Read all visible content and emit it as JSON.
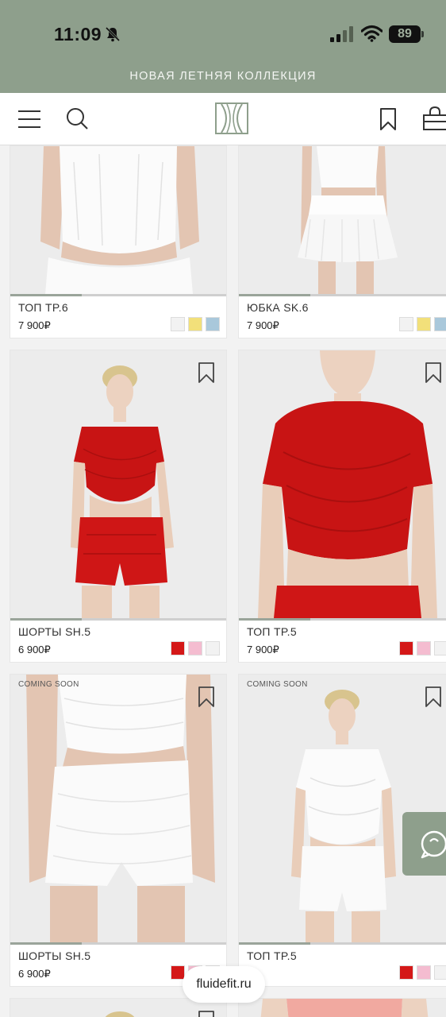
{
  "status_bar": {
    "time": "11:09",
    "battery": "89"
  },
  "promo_banner": "НОВАЯ ЛЕТНЯЯ КОЛЛЕКЦИЯ",
  "products": [
    {
      "name": "ТОП TP.6",
      "price": "7 900₽",
      "colors": [
        "#f2f2f2",
        "#f2e07a",
        "#a9c8db"
      ]
    },
    {
      "name": "ЮБКА SK.6",
      "price": "7 900₽",
      "colors": [
        "#f2f2f2",
        "#f2e07a",
        "#a9c8db"
      ]
    },
    {
      "name": "ШОРТЫ SH.5",
      "price": "6 900₽",
      "colors": [
        "#d41818",
        "#f4bcd0",
        "#f2f2f2"
      ]
    },
    {
      "name": "ТОП TP.5",
      "price": "7 900₽",
      "colors": [
        "#d41818",
        "#f4bcd0",
        "#f2f2f2"
      ]
    },
    {
      "name": "ШОРТЫ SH.5",
      "price": "6 900₽",
      "badge": "COMING SOON",
      "colors": [
        "#d41818",
        "#f4bcd0",
        "#f2f2f2"
      ]
    },
    {
      "name": "ТОП TP.5",
      "price": "",
      "badge": "COMING SOON",
      "colors": [
        "#d41818",
        "#f4bcd0",
        "#f2f2f2"
      ]
    }
  ],
  "browser": {
    "url": "fluidefit.ru"
  },
  "colors": {
    "brand_green": "#8e9f8c",
    "accent_red": "#d41818"
  }
}
